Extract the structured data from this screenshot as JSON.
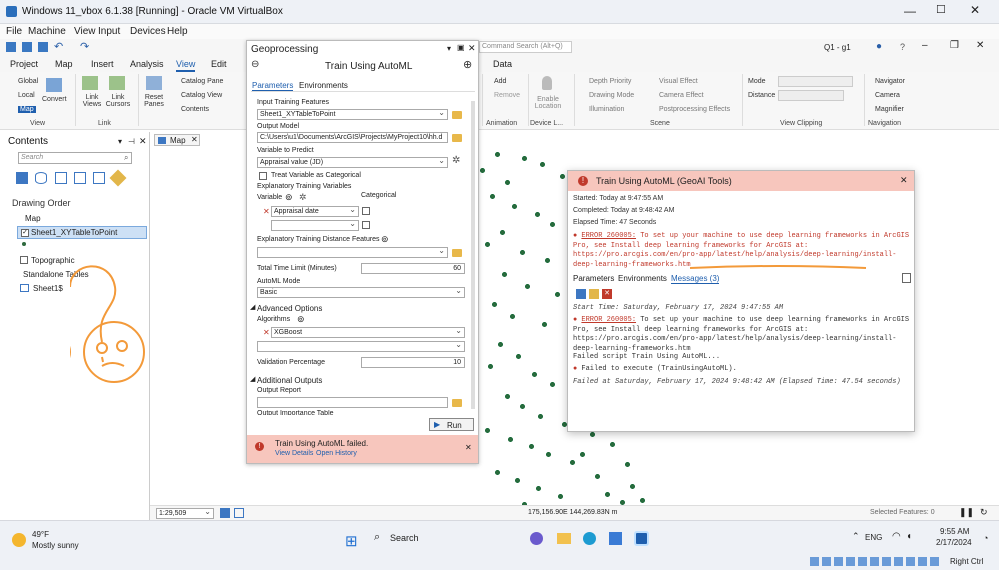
{
  "vbox": {
    "title": "Windows 11_vbox 6.1.38 [Running] - Oracle VM VirtualBox",
    "menu": [
      "File",
      "Machine",
      "View",
      "Input",
      "Devices",
      "Help"
    ],
    "host_key": "Right Ctrl"
  },
  "app": {
    "command_search_placeholder": "Command Search (Alt+Q)",
    "user": "Q1 - g1",
    "tabs": [
      "Project",
      "Map",
      "Insert",
      "Analysis",
      "View",
      "Edit"
    ],
    "active_tab": "View",
    "data_tab": "Data"
  },
  "ribbon": {
    "global": "Global",
    "local": "Local",
    "map": "Map",
    "convert": "Convert",
    "link_views": "Link Views",
    "link_cursors": "Link Cursors",
    "reset_panes": "Reset Panes",
    "catalog_pane": "Catalog Pane",
    "catalog_view": "Catalog View",
    "contents": "Contents",
    "add": "Add",
    "remove": "Remove",
    "enable_location": "Enable Location",
    "depth_priority": "Depth Priority",
    "drawing_mode": "Drawing Mode",
    "illumination": "Illumination",
    "visual_effect": "Visual Effect",
    "camera_effect": "Camera Effect",
    "postprocessing_effects": "Postprocessing Effects",
    "mode": "Mode",
    "distance": "Distance",
    "navigator": "Navigator",
    "camera": "Camera",
    "magnifier": "Magnifier",
    "groups": [
      "View",
      "Link",
      "Animation",
      "Device L...",
      "Scene",
      "View Clipping",
      "Navigation"
    ]
  },
  "contents": {
    "title": "Contents",
    "search_placeholder": "Search",
    "drawing_order": "Drawing Order",
    "map": "Map",
    "layer": "Sheet1_XYTableToPoint",
    "topographic": "Topographic",
    "standalone": "Standalone Tables",
    "sheet": "Sheet1$"
  },
  "map_tab": "Map",
  "geoprocessing": {
    "pane_title": "Geoprocessing",
    "tool_title": "Train Using AutoML",
    "tabs": [
      "Parameters",
      "Environments"
    ],
    "input_label": "Input Training Features",
    "input_value": "Sheet1_XYTableToPoint",
    "output_label": "Output Model",
    "output_value": "C:\\Users\\u1\\Documents\\ArcGIS\\Projects\\MyProject10\\hh.d",
    "predict_label": "Variable to Predict",
    "predict_value": "Appraisal value (JD)",
    "categorical_check": "Treat Variable as Categorical",
    "explanatory_label": "Explanatory Training Variables",
    "variable_col": "Variable",
    "categorical_col": "Categorical",
    "variable_value": "Appraisal date",
    "distance_label": "Explanatory Training Distance Features",
    "time_label": "Total Time Limit (Minutes)",
    "time_value": "60",
    "mode_label": "AutoML Mode",
    "mode_value": "Basic",
    "advanced": "Advanced Options",
    "algorithms_label": "Algorithms",
    "algorithm_value": "XGBoost",
    "validation_label": "Validation Percentage",
    "validation_value": "10",
    "additional": "Additional Outputs",
    "report_label": "Output Report",
    "importance_label": "Output Importance Table",
    "run": "Run",
    "failed_msg": "Train Using AutoML failed.",
    "view_details": "View Details",
    "open_history": "Open History"
  },
  "popup": {
    "title": "Train Using AutoML (GeoAI Tools)",
    "started": "Started: Today at 9:47:55 AM",
    "completed": "Completed: Today at 9:48:42 AM",
    "elapsed": "Elapsed Time: 47 Seconds",
    "error_code": "ERROR 260005:",
    "error_text": "To set up your machine to use deep learning frameworks in ArcGIS Pro, see Install deep learning frameworks for ArcGIS at: https://pro.arcgis.com/en/pro-app/latest/help/analysis/deep-learning/install-deep-learning-frameworks.htm",
    "tabs": [
      "Parameters",
      "Environments",
      "Messages (3)"
    ],
    "start_time": "Start Time: Saturday, February 17, 2024 9:47:55 AM",
    "err2_code": "ERROR 260005:",
    "err2_text": "To set up your machine to use deep learning frameworks in ArcGIS Pro, see Install deep learning frameworks for ArcGIS at: https://pro.arcgis.com/en/pro-app/latest/help/analysis/deep-learning/install-deep-learning-frameworks.htm",
    "failed_script": "Failed script Train Using AutoML...",
    "failed_exec": "Failed to execute (TrainUsingAutoML).",
    "failed_at": "Failed at Saturday, February 17, 2024 9:48:42 AM (Elapsed Time: 47.54 seconds)"
  },
  "statusbar": {
    "scale": "1:29,509",
    "coords": "175,156.90E 144,269.83N m",
    "selected": "Selected Features: 0"
  },
  "taskbar": {
    "temp": "49°F",
    "weather": "Mostly sunny",
    "search": "Search",
    "lang": "ENG",
    "time": "9:55 AM",
    "date": "2/17/2024"
  }
}
